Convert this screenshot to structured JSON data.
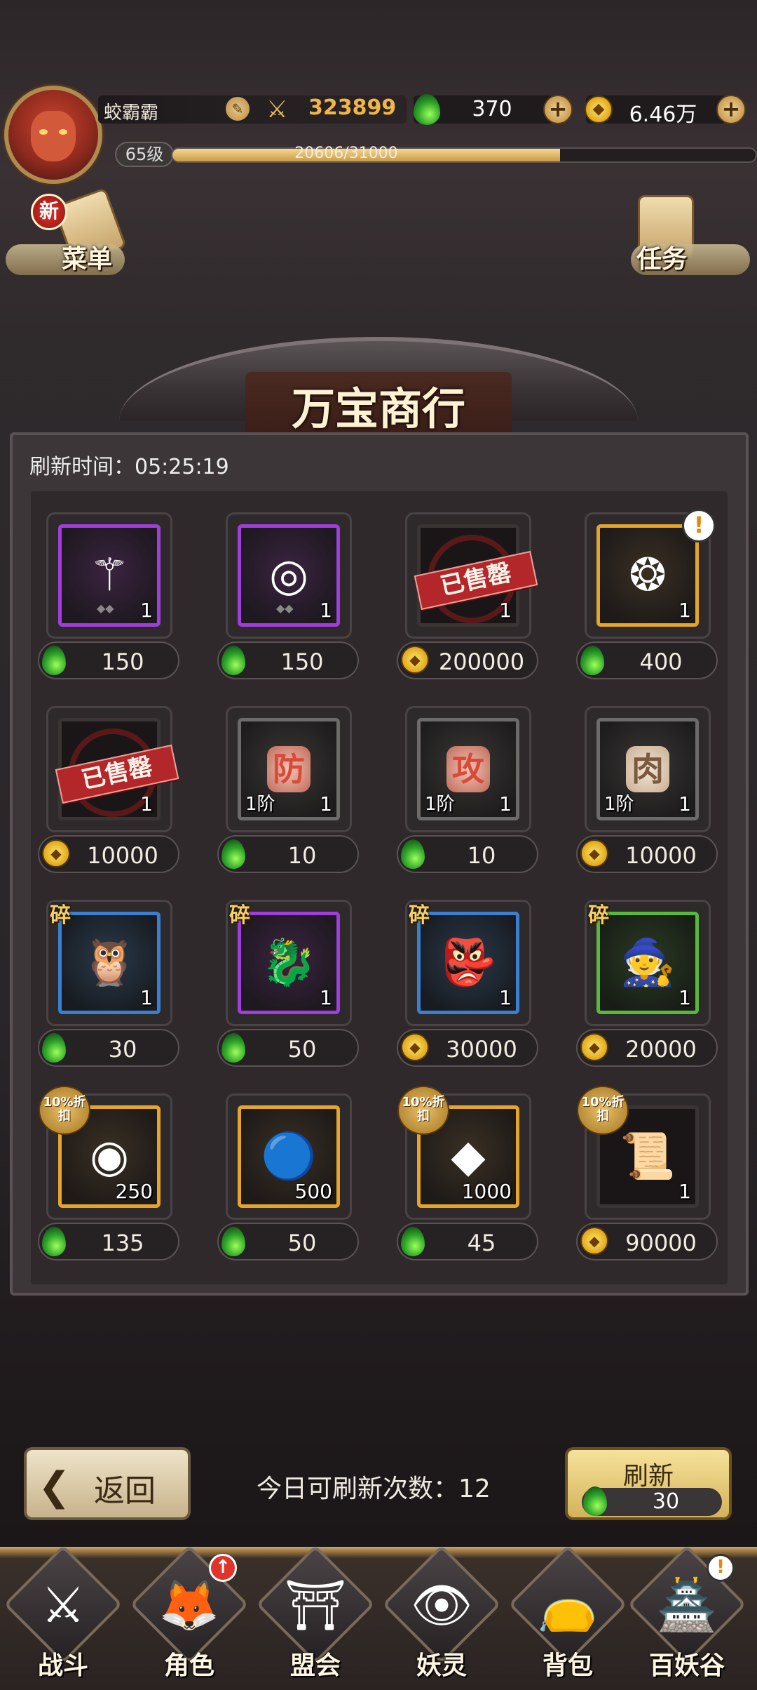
{
  "player": {
    "name": "蛟霸霸",
    "power": "323899",
    "level": "65级",
    "xp_text": "20606/31000",
    "xp_fraction": 0.665
  },
  "currency": {
    "jade": "370",
    "gold": "6.46万"
  },
  "side": {
    "menu_label": "菜单",
    "menu_new_badge": "新",
    "task_label": "任务"
  },
  "shop": {
    "title": "万宝商行",
    "refresh_time": "刷新时间：05:25:19",
    "sold_label": "已售罄"
  },
  "items": [
    {
      "name": "staff",
      "frame": "purple",
      "qty": "1",
      "tier": "",
      "sold": false,
      "frag": false,
      "discount": false,
      "alert": false,
      "currency": "jade",
      "price": "150",
      "icon": "staff-icon",
      "glyph": "⚚"
    },
    {
      "name": "ring",
      "frame": "purple",
      "qty": "1",
      "tier": "",
      "sold": false,
      "frag": false,
      "discount": false,
      "alert": false,
      "currency": "jade",
      "price": "150",
      "icon": "ring-icon",
      "glyph": "◎"
    },
    {
      "name": "sold-item-1",
      "frame": "black",
      "qty": "1",
      "tier": "",
      "sold": true,
      "frag": false,
      "discount": false,
      "alert": false,
      "currency": "gold",
      "price": "200000",
      "icon": "sold-out-icon",
      "glyph": ""
    },
    {
      "name": "amulet",
      "frame": "gold",
      "qty": "1",
      "tier": "",
      "sold": false,
      "frag": false,
      "discount": false,
      "alert": true,
      "currency": "jade",
      "price": "400",
      "icon": "amulet-icon",
      "glyph": "❂"
    },
    {
      "name": "sold-item-2",
      "frame": "black",
      "qty": "1",
      "tier": "",
      "sold": true,
      "frag": false,
      "discount": false,
      "alert": false,
      "currency": "gold",
      "price": "10000",
      "icon": "sold-out-icon",
      "glyph": ""
    },
    {
      "name": "defense-stone",
      "frame": "gray",
      "qty": "1",
      "tier": "1阶",
      "sold": false,
      "frag": false,
      "discount": false,
      "alert": false,
      "currency": "jade",
      "price": "10",
      "icon": "defense-stone-icon",
      "glyph": "防"
    },
    {
      "name": "attack-stone",
      "frame": "gray",
      "qty": "1",
      "tier": "1阶",
      "sold": false,
      "frag": false,
      "discount": false,
      "alert": false,
      "currency": "jade",
      "price": "10",
      "icon": "attack-stone-icon",
      "glyph": "攻"
    },
    {
      "name": "body-stone",
      "frame": "gray",
      "qty": "1",
      "tier": "1阶",
      "sold": false,
      "frag": false,
      "discount": false,
      "alert": false,
      "currency": "gold",
      "price": "10000",
      "icon": "body-stone-icon",
      "glyph": "肉"
    },
    {
      "name": "shard-owl",
      "frame": "blue",
      "qty": "1",
      "tier": "",
      "sold": false,
      "frag": true,
      "discount": false,
      "alert": false,
      "currency": "jade",
      "price": "30",
      "icon": "monster-shard-icon",
      "glyph": "🦉"
    },
    {
      "name": "shard-dragon",
      "frame": "purple",
      "qty": "1",
      "tier": "",
      "sold": false,
      "frag": true,
      "discount": false,
      "alert": false,
      "currency": "jade",
      "price": "50",
      "icon": "dragon-shard-icon",
      "glyph": "🐉"
    },
    {
      "name": "shard-twins",
      "frame": "blue",
      "qty": "1",
      "tier": "",
      "sold": false,
      "frag": true,
      "discount": false,
      "alert": false,
      "currency": "gold",
      "price": "30000",
      "icon": "twins-shard-icon",
      "glyph": "👺"
    },
    {
      "name": "shard-witch",
      "frame": "green",
      "qty": "1",
      "tier": "",
      "sold": false,
      "frag": true,
      "discount": false,
      "alert": false,
      "currency": "gold",
      "price": "20000",
      "icon": "witch-shard-icon",
      "glyph": "🧙"
    },
    {
      "name": "white-orb",
      "frame": "gold",
      "qty": "250",
      "tier": "",
      "sold": false,
      "frag": false,
      "discount": true,
      "alert": false,
      "currency": "jade",
      "price": "135",
      "icon": "white-orb-icon",
      "glyph": "◉"
    },
    {
      "name": "blue-flame",
      "frame": "gold",
      "qty": "500",
      "tier": "",
      "sold": false,
      "frag": false,
      "discount": false,
      "alert": false,
      "currency": "jade",
      "price": "50",
      "icon": "blue-flame-icon",
      "glyph": "🔵"
    },
    {
      "name": "ore",
      "frame": "gold",
      "qty": "1000",
      "tier": "",
      "sold": false,
      "frag": false,
      "discount": true,
      "alert": false,
      "currency": "jade",
      "price": "45",
      "icon": "ore-icon",
      "glyph": "◆"
    },
    {
      "name": "scroll",
      "frame": "black",
      "qty": "1",
      "tier": "",
      "sold": false,
      "frag": false,
      "discount": true,
      "alert": false,
      "currency": "gold",
      "price": "90000",
      "icon": "scroll-icon",
      "glyph": "📜"
    }
  ],
  "labels": {
    "fragment": "碎",
    "discount": "10%折扣"
  },
  "footer": {
    "back_label": "返回",
    "refresh_count": "今日可刷新次数：12",
    "refresh_label": "刷新",
    "refresh_cost": "30"
  },
  "nav": [
    {
      "id": "battle",
      "label": "战斗",
      "glyph": "⚔",
      "badge": ""
    },
    {
      "id": "role",
      "label": "角色",
      "glyph": "🦊",
      "badge": "↑"
    },
    {
      "id": "guild",
      "label": "盟会",
      "glyph": "⛩",
      "badge": ""
    },
    {
      "id": "spirit",
      "label": "妖灵",
      "glyph": "👁",
      "badge": ""
    },
    {
      "id": "bag",
      "label": "背包",
      "glyph": "👝",
      "badge": ""
    },
    {
      "id": "valley",
      "label": "百妖谷",
      "glyph": "🏯",
      "badge": "!"
    }
  ],
  "colors": {
    "jade": "#2fa52a",
    "gold": "#e0a81c",
    "frame_purple": "#a13ddb",
    "frame_gold": "#e4a52c",
    "frame_blue": "#3a7fd0",
    "frame_green": "#58b83a"
  }
}
